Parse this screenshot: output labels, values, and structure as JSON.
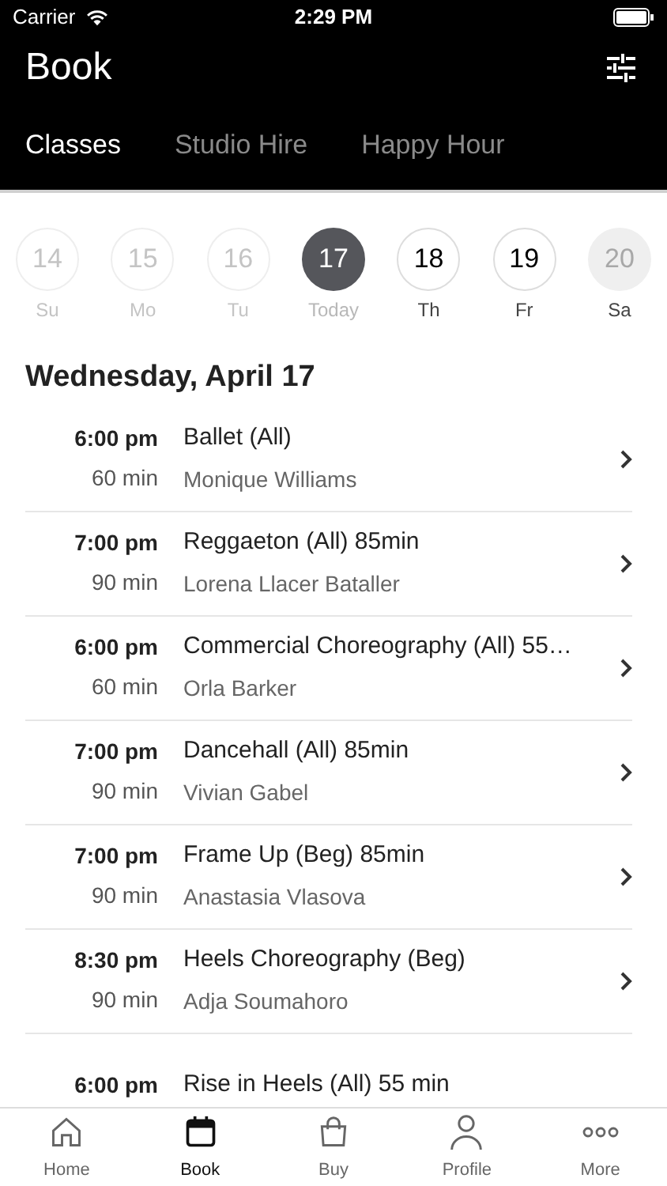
{
  "status_bar": {
    "carrier": "Carrier",
    "time": "2:29 PM"
  },
  "header": {
    "title": "Book"
  },
  "tabs": [
    {
      "label": "Classes",
      "selected": true
    },
    {
      "label": "Studio Hire",
      "selected": false
    },
    {
      "label": "Happy Hour",
      "selected": false
    }
  ],
  "days": [
    {
      "number": "14",
      "label": "Su",
      "kind": "past",
      "selected": false
    },
    {
      "number": "15",
      "label": "Mo",
      "kind": "past",
      "selected": false
    },
    {
      "number": "16",
      "label": "Tu",
      "kind": "past",
      "selected": false
    },
    {
      "number": "17",
      "label": "Today",
      "kind": "today",
      "selected": true
    },
    {
      "number": "18",
      "label": "Th",
      "kind": "open",
      "selected": false
    },
    {
      "number": "19",
      "label": "Fr",
      "kind": "open",
      "selected": false
    },
    {
      "number": "20",
      "label": "Sa",
      "kind": "closed",
      "selected": false
    }
  ],
  "date_heading": "Wednesday, April 17",
  "classes": [
    {
      "time": "6:00 pm",
      "duration": "60 min",
      "name": "Ballet (All)",
      "teacher": "Monique Williams"
    },
    {
      "time": "7:00 pm",
      "duration": "90 min",
      "name": "Reggaeton (All) 85min",
      "teacher": "Lorena Llacer Bataller"
    },
    {
      "time": "6:00 pm",
      "duration": "60 min",
      "name": "Commercial Choreography (All) 55…",
      "teacher": "Orla Barker"
    },
    {
      "time": "7:00 pm",
      "duration": "90 min",
      "name": "Dancehall (All) 85min",
      "teacher": "Vivian Gabel"
    },
    {
      "time": "7:00 pm",
      "duration": "90 min",
      "name": "Frame Up (Beg) 85min",
      "teacher": "Anastasia Vlasova"
    },
    {
      "time": "8:30 pm",
      "duration": "90 min",
      "name": "Heels Choreography (Beg)",
      "teacher": "Adja Soumahoro"
    },
    {
      "time": "6:00 pm",
      "name": "Rise in Heels (All) 55 min"
    }
  ],
  "nav": [
    {
      "label": "Home",
      "selected": false
    },
    {
      "label": "Book",
      "selected": true
    },
    {
      "label": "Buy",
      "selected": false
    },
    {
      "label": "Profile",
      "selected": false
    },
    {
      "label": "More",
      "selected": false
    }
  ]
}
